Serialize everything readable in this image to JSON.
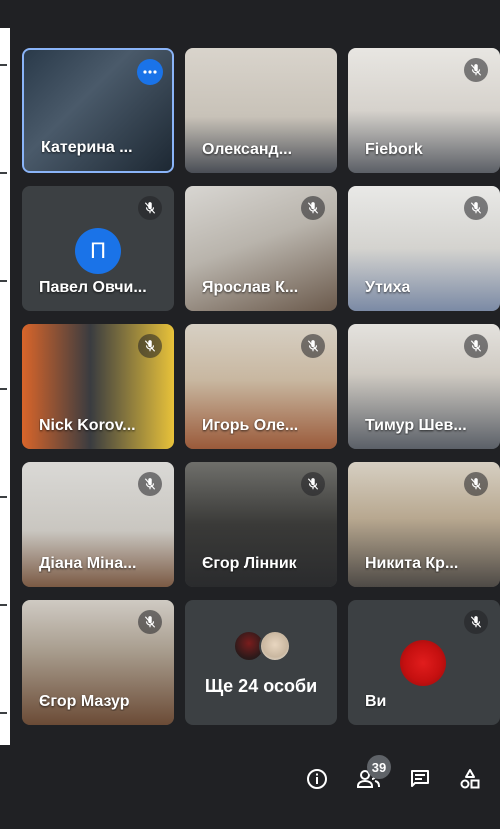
{
  "participants": [
    {
      "name": "Катерина ...",
      "muted": false,
      "active": true
    },
    {
      "name": "Олександ...",
      "muted": false,
      "active": false
    },
    {
      "name": "Fiebork",
      "muted": true,
      "active": false
    },
    {
      "name": "Павел Овчи...",
      "muted": true,
      "active": false,
      "initial": "П"
    },
    {
      "name": "Ярослав К...",
      "muted": true,
      "active": false
    },
    {
      "name": "Утиха",
      "muted": true,
      "active": false
    },
    {
      "name": "Nick Korov...",
      "muted": true,
      "active": false
    },
    {
      "name": "Игорь Оле...",
      "muted": true,
      "active": false
    },
    {
      "name": "Тимур Шев...",
      "muted": true,
      "active": false
    },
    {
      "name": "Діана Міна...",
      "muted": true,
      "active": false
    },
    {
      "name": "Єгор Лінник",
      "muted": true,
      "active": false
    },
    {
      "name": "Никита Кр...",
      "muted": true,
      "active": false
    },
    {
      "name": "Єгор Мазур",
      "muted": true,
      "active": false
    }
  ],
  "more_tile": {
    "label": "Ще 24 особи"
  },
  "self_tile": {
    "name": "Ви",
    "muted": true
  },
  "toolbar": {
    "info_icon": "info-icon",
    "people_icon": "people-icon",
    "people_count": "39",
    "chat_icon": "chat-icon",
    "activities_icon": "activities-icon"
  },
  "colors": {
    "background": "#202124",
    "tile": "#3c4043",
    "accent": "#1a73e8",
    "active_outline": "#8ab4f8"
  }
}
